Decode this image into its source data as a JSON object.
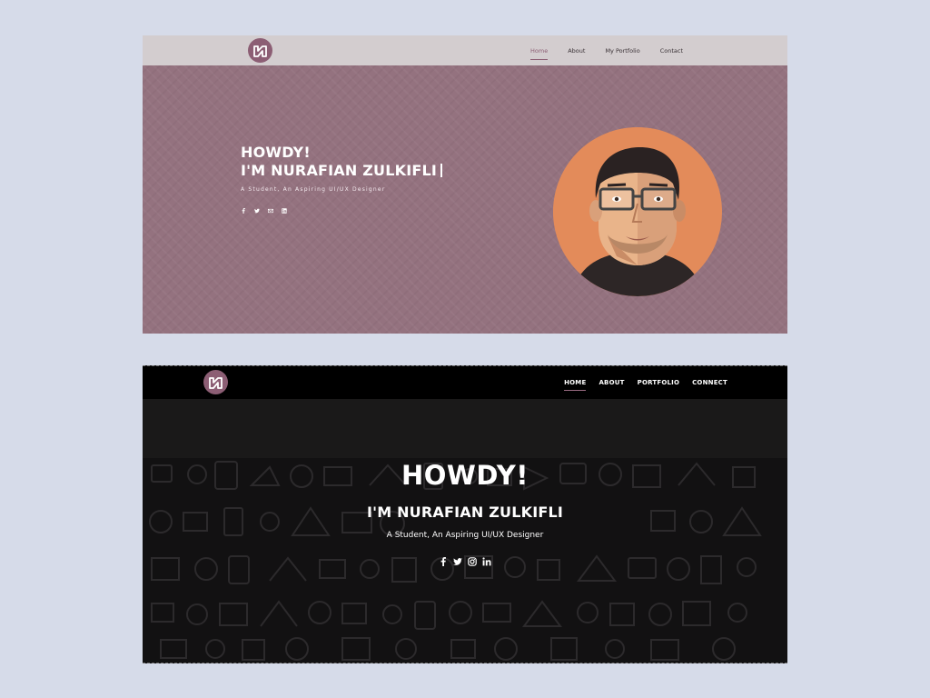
{
  "light": {
    "nav": {
      "items": [
        "Home",
        "About",
        "My Portfolio",
        "Contact"
      ],
      "active": "Home"
    },
    "hero": {
      "line1": "HOWDY!",
      "line2": "I'M NURAFIAN ZULKIFLI",
      "subtitle": "A Student, An Aspiring UI/UX Designer"
    },
    "socials": [
      "facebook-icon",
      "twitter-icon",
      "mail-icon",
      "linkedin-icon"
    ],
    "colors": {
      "nav_bg": "#d3cdcf",
      "hero_bg": "#94727f",
      "accent": "#8c5e74",
      "avatar_bg": "#e38b5a"
    }
  },
  "dark": {
    "nav": {
      "items": [
        "HOME",
        "ABOUT",
        "PORTFOLIO",
        "CONNECT"
      ],
      "active": "HOME"
    },
    "hero": {
      "line1": "HOWDY!",
      "line2": "I'M NURAFIAN ZULKIFLI",
      "subtitle": "A Student, An Aspiring UI/UX Designer"
    },
    "socials": [
      "facebook-icon",
      "twitter-icon",
      "instagram-icon",
      "linkedin-icon"
    ],
    "colors": {
      "nav_bg": "#000000",
      "hero_bg": "#121112",
      "accent": "#9a6b82"
    }
  }
}
